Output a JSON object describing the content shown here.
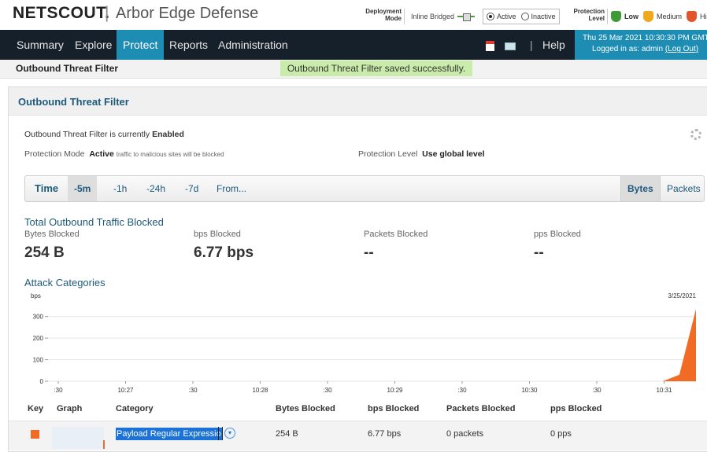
{
  "header": {
    "logo": "NETSCOUT.",
    "separator": "|",
    "product": "Arbor Edge Defense",
    "deployment_label_1": "Deployment",
    "deployment_label_2": "Mode",
    "deployment_mode": "Inline Bridged",
    "mode_active": "Active",
    "mode_inactive": "Inactive",
    "protection_label_1": "Protection",
    "protection_label_2": "Level",
    "level_low": "Low",
    "level_medium": "Medium",
    "level_high": "Hig",
    "colors": {
      "low": "#3f9b35",
      "medium": "#f0a81c",
      "high": "#e2542b"
    }
  },
  "nav": {
    "items": [
      "Summary",
      "Explore",
      "Protect",
      "Reports",
      "Administration"
    ],
    "active": "Protect",
    "pipe": "|",
    "help": "Help",
    "datetime": "Thu 25 Mar 2021 10:30:30 PM GMT",
    "logged_in_prefix": "Logged in as: admin",
    "logout": "(Log Out)",
    "icons": [
      "pdf-icon",
      "email-icon"
    ]
  },
  "page": {
    "title": "Outbound Threat Filter",
    "toast": "Outbound Threat Filter saved successfully."
  },
  "panel": {
    "title": "Outbound Threat Filter",
    "status_prefix": "Outbound Threat Filter is currently",
    "status_value": "Enabled",
    "mode_label": "Protection Mode",
    "mode_value": "Active",
    "mode_note": "traffic to malicious sites will be blocked",
    "level_label": "Protection Level",
    "level_value": "Use global level"
  },
  "toolbar": {
    "time_label": "Time",
    "ranges": [
      "-5m",
      "-1h",
      "-24h",
      "-7d",
      "From..."
    ],
    "selected_range": "-5m",
    "units": [
      "Bytes",
      "Packets"
    ],
    "selected_unit": "Bytes"
  },
  "totals": {
    "title": "Total Outbound Traffic Blocked",
    "bytes_label": "Bytes Blocked",
    "bytes_value": "254 B",
    "bps_label": "bps Blocked",
    "bps_value": "6.77 bps",
    "packets_label": "Packets Blocked",
    "packets_value": "--",
    "pps_label": "pps Blocked",
    "pps_value": "--"
  },
  "attack": {
    "title": "Attack Categories"
  },
  "chart_data": {
    "type": "area",
    "ylabel": "bps",
    "date_label": "3/25/2021",
    "ylim": [
      0,
      350
    ],
    "yticks": [
      0,
      100,
      200,
      300
    ],
    "xtick_labels": [
      ":30",
      "10:27",
      ":30",
      "10:28",
      ":30",
      "10:29",
      ":30",
      "10:30",
      ":30",
      "10:31"
    ],
    "series": [
      {
        "values": [
          0,
          0,
          0,
          0,
          0,
          0,
          0,
          0,
          0,
          0,
          0,
          0,
          0,
          0,
          0,
          0,
          0,
          0,
          0,
          0,
          0,
          0,
          0,
          0,
          0,
          0,
          0,
          0,
          0,
          0,
          0,
          0,
          0,
          0,
          0,
          0,
          0,
          0,
          30,
          335
        ],
        "color": "#f26b24"
      }
    ]
  },
  "table": {
    "headers": [
      "Key",
      "Graph",
      "Category",
      "Bytes Blocked",
      "bps Blocked",
      "Packets Blocked",
      "pps Blocked"
    ],
    "rows": [
      {
        "key_color": "#f26b24",
        "category": "Payload Regular Expressio",
        "bytes": "254 B",
        "bps": "6.77 bps",
        "packets": "0 packets",
        "pps": "0 pps"
      }
    ]
  }
}
